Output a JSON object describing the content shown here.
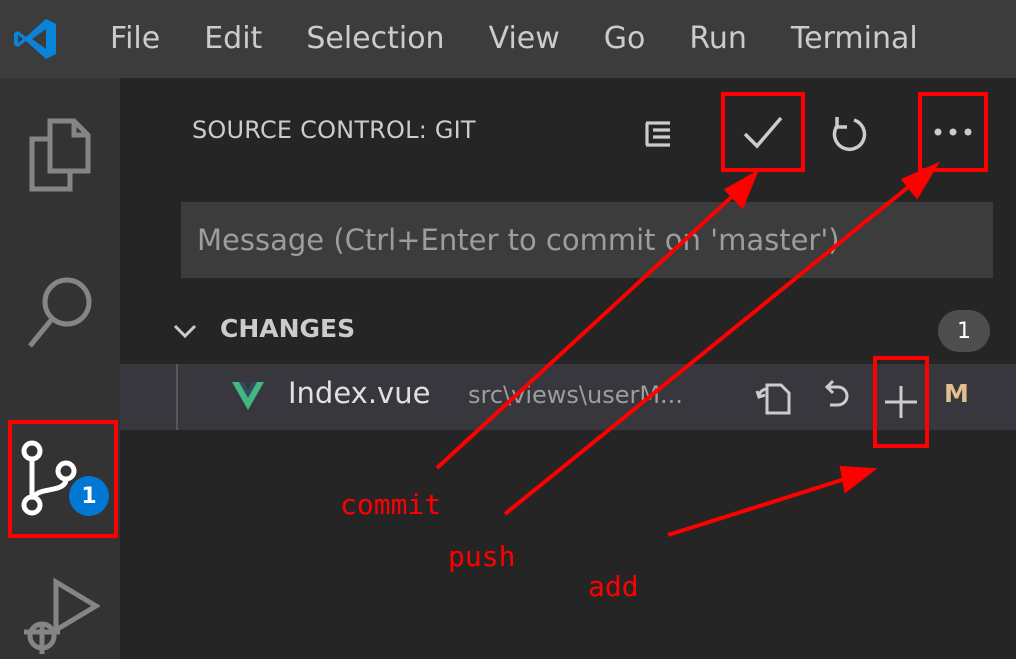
{
  "menubar": {
    "logo_icon": "vscode-logo-icon",
    "items": [
      "File",
      "Edit",
      "Selection",
      "View",
      "Go",
      "Run",
      "Terminal"
    ]
  },
  "activitybar": {
    "items": [
      {
        "name": "explorer",
        "icon": "files-icon"
      },
      {
        "name": "search",
        "icon": "search-icon"
      },
      {
        "name": "source-control",
        "icon": "source-control-icon",
        "badge": "1"
      },
      {
        "name": "run-debug",
        "icon": "run-debug-icon"
      }
    ]
  },
  "scm": {
    "title": "SOURCE CONTROL: GIT",
    "toolbar": {
      "view_tree_icon": "view-as-tree-icon",
      "commit_icon": "check-icon",
      "refresh_icon": "refresh-icon",
      "more_icon": "ellipsis-icon"
    },
    "message_placeholder": "Message (Ctrl+Enter to commit on 'master')",
    "changes": {
      "label": "CHANGES",
      "count": "1",
      "files": [
        {
          "name": "Index.vue",
          "path": "src\\views\\userM...",
          "status": "M",
          "icon": "vue-icon"
        }
      ]
    }
  },
  "annotations": {
    "commit": "commit",
    "push": "push",
    "add": "add"
  },
  "colors": {
    "highlight": "#ff0000",
    "badge": "#0078d4",
    "modified": "#e2c08d",
    "vue_green": "#41b883"
  }
}
